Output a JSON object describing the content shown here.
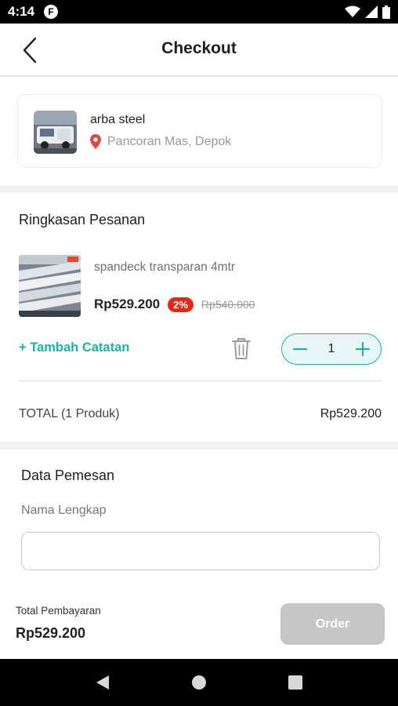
{
  "status_bar": {
    "time": "4:14",
    "app_icon_letter": "F"
  },
  "header": {
    "title": "Checkout"
  },
  "seller": {
    "name": "arba steel",
    "location": "Pancoran Mas, Depok"
  },
  "summary": {
    "title": "Ringkasan Pesanan",
    "product": {
      "name": "spandeck transparan 4mtr",
      "price": "Rp529.200",
      "discount": "2%",
      "original_price": "Rp540.000",
      "quantity": "1"
    },
    "add_note_label": "+ Tambah Catatan",
    "total_label": "TOTAL (1 Produk)",
    "total_value": "Rp529.200"
  },
  "order_data": {
    "title": "Data Pemesan",
    "name_label": "Nama Lengkap",
    "name_value": "",
    "name_placeholder": ""
  },
  "footer": {
    "payment_label": "Total Pembayaran",
    "payment_value": "Rp529.200",
    "order_button": "Order"
  },
  "colors": {
    "accent": "#1bb3a2",
    "discount_badge": "#e4261b",
    "disabled_button": "#c6c6c6",
    "location_pin": "#e04848"
  }
}
